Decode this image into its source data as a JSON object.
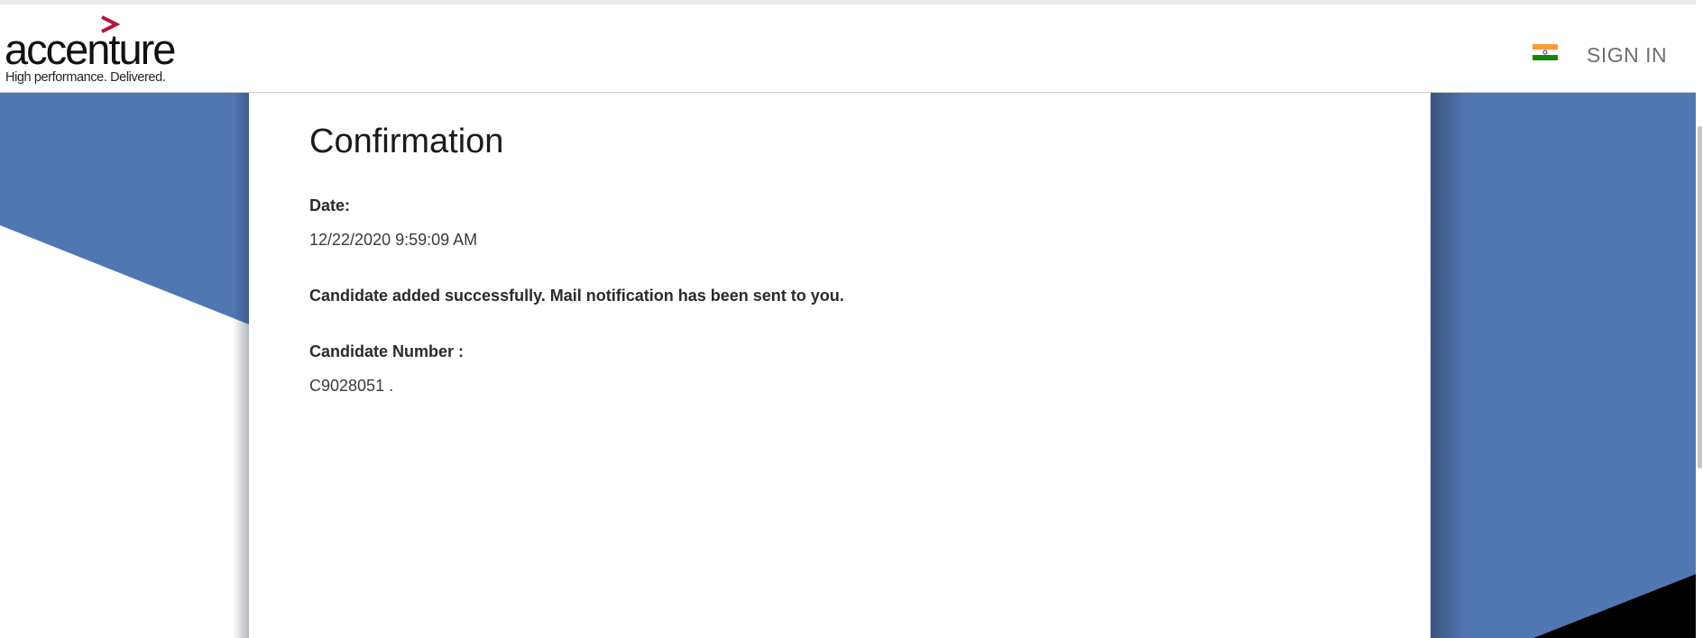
{
  "header": {
    "logo_text": "accenture",
    "logo_tagline": "High performance. Delivered.",
    "sign_in_label": "SIGN IN",
    "flag_icon": "india-flag-icon"
  },
  "confirmation": {
    "title": "Confirmation",
    "date_label": "Date:",
    "date_value": "12/22/2020 9:59:09 AM",
    "message": "Candidate added successfully. Mail notification has been sent to you.",
    "candidate_number_label": "Candidate Number :",
    "candidate_number_value": "C9028051 ."
  },
  "colors": {
    "accent_blue": "#5177b3",
    "logo_chevron": "#b3153b",
    "flag_saffron": "#ff9933",
    "flag_green": "#138808"
  }
}
